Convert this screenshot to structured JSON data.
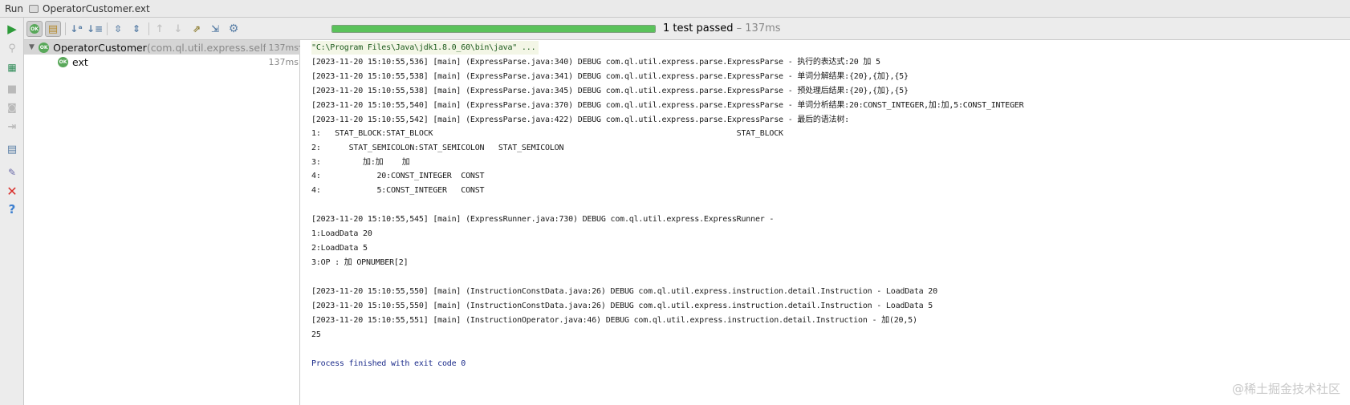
{
  "window": {
    "tool_label": "Run",
    "config_name": "OperatorCustomer.ext"
  },
  "toolbar": {
    "status_count": "1 test passed",
    "status_duration": " – 137ms",
    "progress_percent": 100,
    "ok_badge": "OK"
  },
  "tree": {
    "root": {
      "name": "OperatorCustomer",
      "package": " (com.ql.util.express.self.custor",
      "time": "137ms"
    },
    "child": {
      "name": "ext",
      "time": "137ms"
    }
  },
  "console": {
    "lines": [
      "\"C:\\Program Files\\Java\\jdk1.8.0_60\\bin\\java\" ...",
      "[2023-11-20 15:10:55,536] [main] (ExpressParse.java:340) DEBUG com.ql.util.express.parse.ExpressParse - 执行的表达式:20 加 5",
      "[2023-11-20 15:10:55,538] [main] (ExpressParse.java:341) DEBUG com.ql.util.express.parse.ExpressParse - 单词分解结果:{20},{加},{5}",
      "[2023-11-20 15:10:55,538] [main] (ExpressParse.java:345) DEBUG com.ql.util.express.parse.ExpressParse - 预处理后结果:{20},{加},{5}",
      "[2023-11-20 15:10:55,540] [main] (ExpressParse.java:370) DEBUG com.ql.util.express.parse.ExpressParse - 单词分析结果:20:CONST_INTEGER,加:加,5:CONST_INTEGER",
      "[2023-11-20 15:10:55,542] [main] (ExpressParse.java:422) DEBUG com.ql.util.express.parse.ExpressParse - 最后的语法树:",
      "1:   STAT_BLOCK:STAT_BLOCK                                                                 STAT_BLOCK",
      "2:      STAT_SEMICOLON:STAT_SEMICOLON   STAT_SEMICOLON",
      "3:         加:加    加",
      "4:            20:CONST_INTEGER  CONST",
      "4:            5:CONST_INTEGER   CONST",
      "",
      "[2023-11-20 15:10:55,545] [main] (ExpressRunner.java:730) DEBUG com.ql.util.express.ExpressRunner -",
      "1:LoadData 20",
      "2:LoadData 5",
      "3:OP : 加 OPNUMBER[2]",
      "",
      "[2023-11-20 15:10:55,550] [main] (InstructionConstData.java:26) DEBUG com.ql.util.express.instruction.detail.Instruction - LoadData 20",
      "[2023-11-20 15:10:55,550] [main] (InstructionConstData.java:26) DEBUG com.ql.util.express.instruction.detail.Instruction - LoadData 5",
      "[2023-11-20 15:10:55,551] [main] (InstructionOperator.java:46) DEBUG com.ql.util.express.instruction.detail.Instruction - 加(20,5)",
      "25",
      "",
      "Process finished with exit code 0"
    ]
  },
  "watermark": "@稀土掘金技术社区",
  "icons": {
    "left_toolbar": [
      "run-icon",
      "pin-icon",
      "test-config-icon",
      "stop-icon",
      "screenshot-icon",
      "exit-icon",
      "layout-icon",
      "pin-tab-icon",
      "close-icon",
      "help-icon"
    ],
    "top_toolbar": [
      "show-passed-icon",
      "show-ignored-icon",
      "sort-alpha-icon",
      "sort-duration-icon",
      "expand-all-icon",
      "collapse-all-icon",
      "previous-failed-icon",
      "next-failed-icon",
      "export-icon",
      "import-icon",
      "settings-icon"
    ]
  },
  "colors": {
    "progress_green": "#5ac25a",
    "ok_green": "#59a85a",
    "close_red": "#d9302c",
    "help_blue": "#3c7fd0",
    "exit_text": "#1a2a8a"
  }
}
